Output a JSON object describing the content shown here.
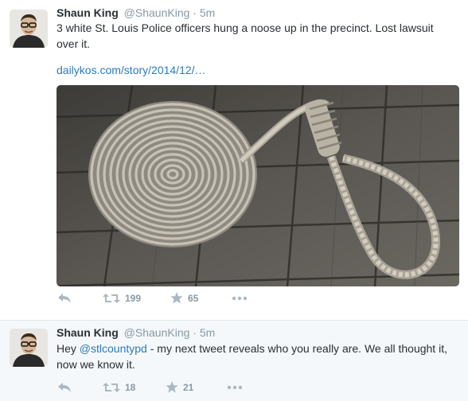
{
  "tweets": [
    {
      "name": "Shaun King",
      "handle": "@ShaunKing",
      "separator": "·",
      "time": "5m",
      "text_line1": "3 white St. Louis Police officers hung a noose up in the precinct. Lost lawsuit",
      "text_line2": "over it.",
      "link": "dailykos.com/story/2014/12/…",
      "retweets": "199",
      "favorites": "65"
    },
    {
      "name": "Shaun King",
      "handle": "@ShaunKing",
      "separator": "·",
      "time": "5m",
      "text_prefix": "Hey ",
      "mention": "@stlcountypd",
      "text_suffix": " - my next tweet reveals who you really are. We all thought it,",
      "text_line2": "now we know it.",
      "retweets": "18",
      "favorites": "21"
    }
  ],
  "icons": {
    "reply": "reply-icon",
    "retweet": "retweet-icon",
    "favorite": "star-icon",
    "more": "more-icon"
  },
  "colors": {
    "link": "#2b7bb9",
    "muted": "#8899a6",
    "text": "#292f33",
    "second_tweet_bg": "#f5f8fa"
  }
}
